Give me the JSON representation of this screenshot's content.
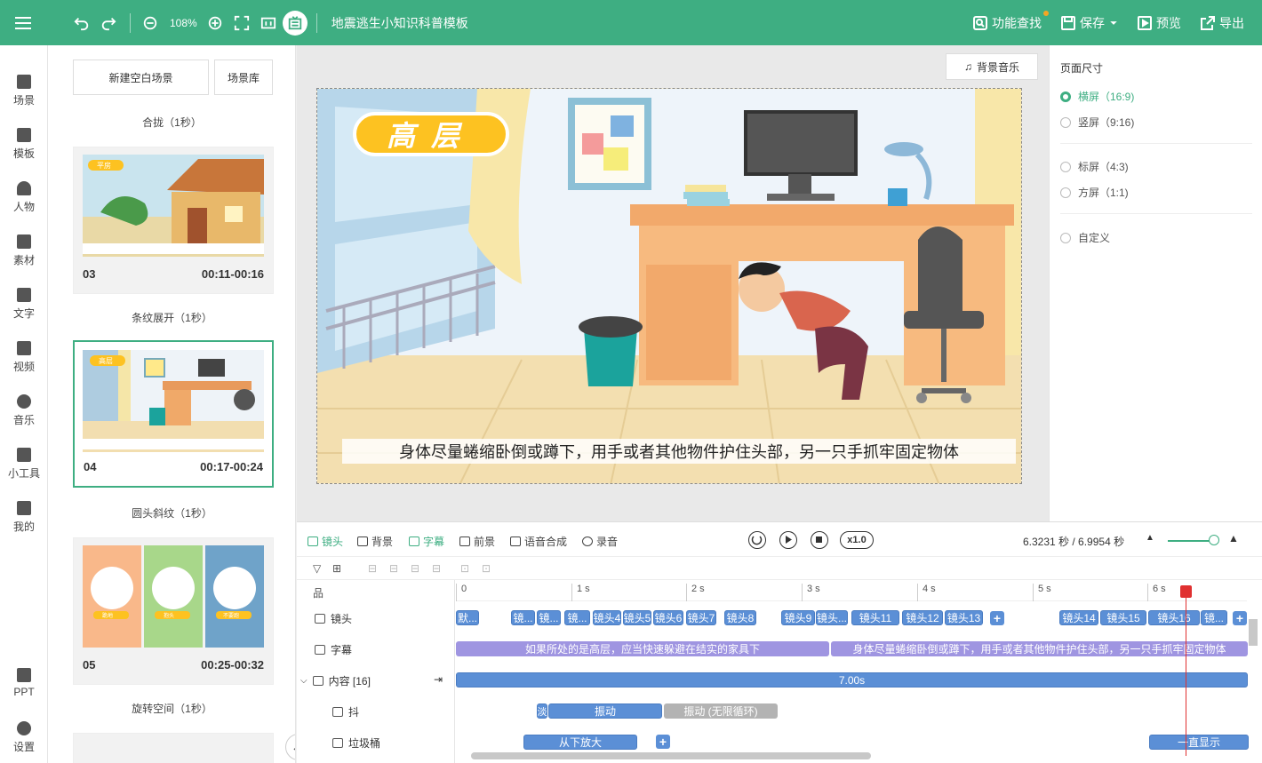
{
  "toolbar": {
    "zoom": "108%",
    "doc_title": "地震逃生小知识科普模板",
    "find_label": "功能查找",
    "save_label": "保存",
    "preview_label": "预览",
    "export_label": "导出"
  },
  "rail": [
    {
      "label": "场景",
      "icon": "scene-icon"
    },
    {
      "label": "模板",
      "icon": "template-icon"
    },
    {
      "label": "人物",
      "icon": "person-icon"
    },
    {
      "label": "素材",
      "icon": "material-icon"
    },
    {
      "label": "文字",
      "icon": "text-icon"
    },
    {
      "label": "视频",
      "icon": "video-icon"
    },
    {
      "label": "音乐",
      "icon": "music-icon"
    },
    {
      "label": "小工具",
      "icon": "tools-icon"
    },
    {
      "label": "我的",
      "icon": "mine-icon"
    },
    {
      "label": "PPT",
      "icon": "ppt-icon"
    },
    {
      "label": "设置",
      "icon": "settings-icon"
    }
  ],
  "scenes": {
    "new_blank": "新建空白场景",
    "library": "场景库",
    "transitions": [
      "合拢（1秒）",
      "条纹展开（1秒）",
      "圆头斜纹（1秒）",
      "旋转空间（1秒）"
    ],
    "cards": [
      {
        "num": "03",
        "range": "00:11-00:16",
        "tag": "平房"
      },
      {
        "num": "04",
        "range": "00:17-00:24",
        "tag": "高层"
      },
      {
        "num": "05",
        "range": "00:25-00:32",
        "tags": [
          "跪地",
          "抱头",
          "不要跑"
        ]
      }
    ]
  },
  "canvas": {
    "bgm_label": "背景音乐",
    "tag": "高层",
    "subtitle": "身体尽量蜷缩卧倒或蹲下，用手或者其他物件护住头部，另一只手抓牢固定物体"
  },
  "page_size": {
    "title": "页面尺寸",
    "options": [
      "横屏（16:9)",
      "竖屏（9:16)",
      "标屏（4:3)",
      "方屏（1:1)",
      "自定义"
    ],
    "selected": 0
  },
  "timeline": {
    "tabs": [
      "镜头",
      "背景",
      "字幕",
      "前景",
      "语音合成",
      "录音"
    ],
    "speed": "x1.0",
    "time": "6.3231 秒 / 6.9954 秒",
    "ticks": [
      "0",
      "1 s",
      "2 s",
      "3 s",
      "4 s",
      "5 s",
      "6 s"
    ],
    "rows": [
      "镜头",
      "字幕",
      "内容 [16]",
      "抖",
      "垃圾桶"
    ],
    "shots": [
      "默...",
      "镜...",
      "镜...",
      "镜...",
      "镜头4",
      "镜头5",
      "镜头6",
      "镜头7",
      "镜头8",
      "镜头9",
      "镜头...",
      "镜头11",
      "镜头12",
      "镜头13",
      "镜头14",
      "镜头15",
      "镜头16",
      "镜..."
    ],
    "subtitles": [
      "如果所处的是高层，应当快速躲避在结实的家具下",
      "身体尽量蜷缩卧倒或蹲下，用手或者其他物件护住头部，另一只手抓牢固定物体"
    ],
    "content_clip": "7.00s",
    "shake_clips": [
      "淡",
      "振动",
      "振动 (无限循环)"
    ],
    "trash_clips": [
      "从下放大",
      "一直显示"
    ]
  }
}
